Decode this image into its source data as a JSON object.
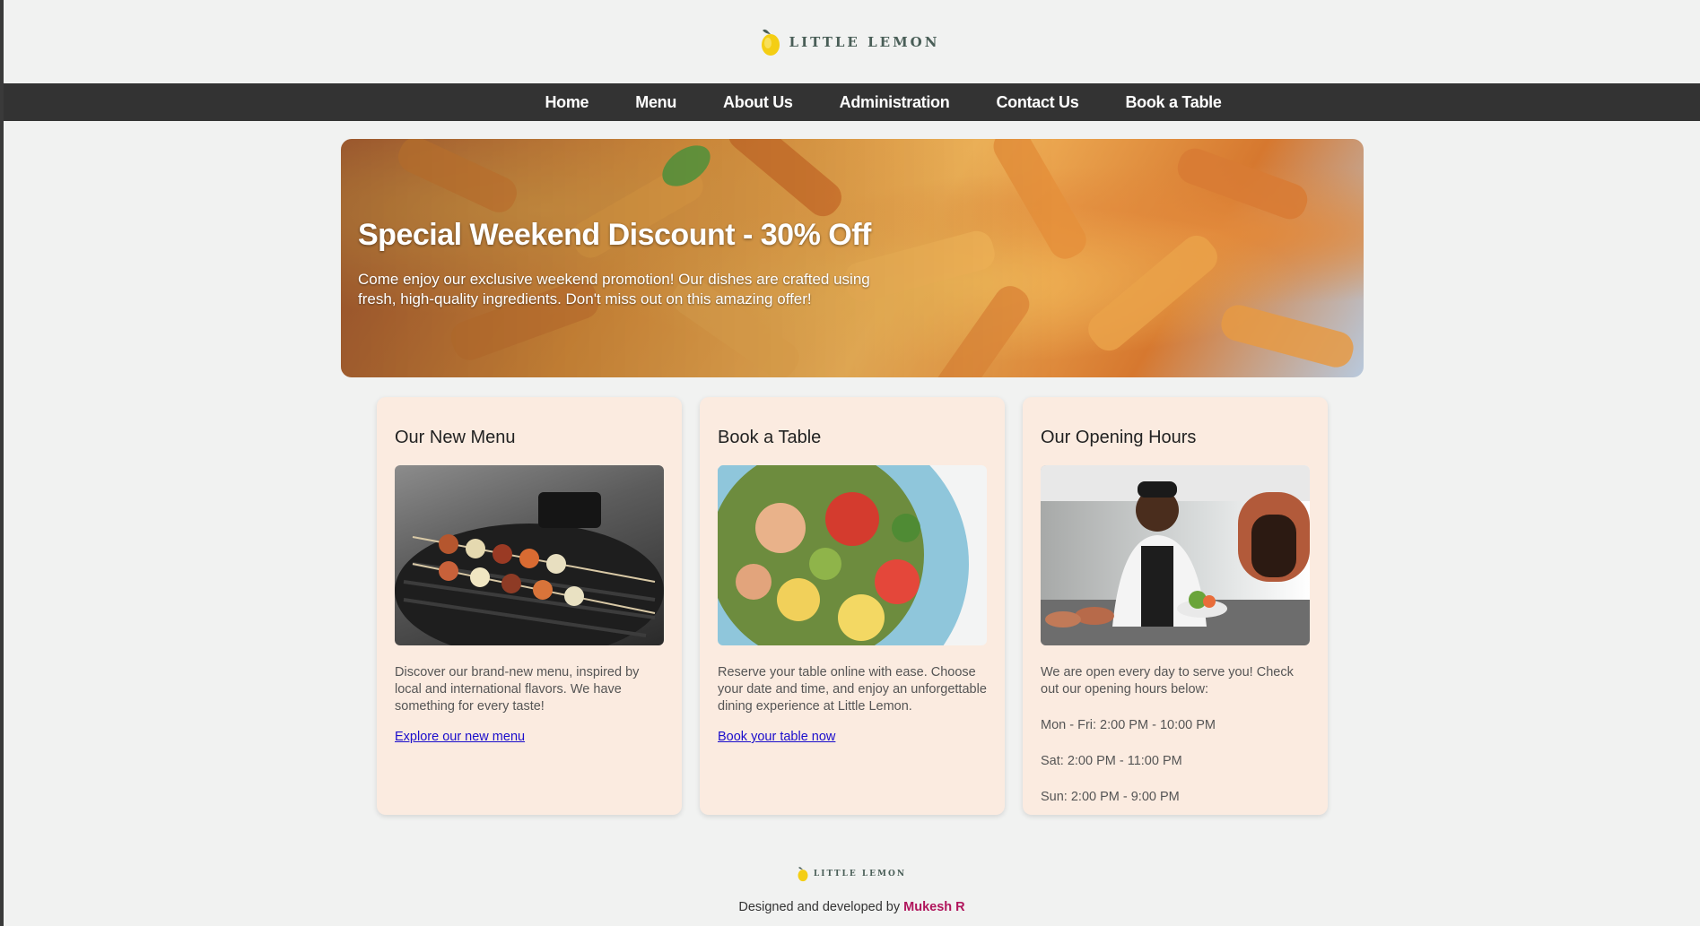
{
  "brand": {
    "name": "LITTLE LEMON"
  },
  "nav": {
    "items": [
      {
        "label": "Home"
      },
      {
        "label": "Menu"
      },
      {
        "label": "About Us"
      },
      {
        "label": "Administration"
      },
      {
        "label": "Contact Us"
      },
      {
        "label": "Book a Table"
      }
    ]
  },
  "hero": {
    "title": "Special Weekend Discount - 30% Off",
    "text": "Come enjoy our exclusive weekend promotion! Our dishes are crafted using fresh, high-quality ingredients. Don't miss out on this amazing offer!"
  },
  "cards": [
    {
      "title": "Our New Menu",
      "text": "Discover our brand-new menu, inspired by local and international flavors. We have something for every taste!",
      "link": "Explore our new menu"
    },
    {
      "title": "Book a Table",
      "text": "Reserve your table online with ease. Choose your date and time, and enjoy an unforgettable dining experience at Little Lemon.",
      "link": "Book your table now"
    },
    {
      "title": "Our Opening Hours",
      "text": "We are open every day to serve you! Check out our opening hours below:",
      "hours": [
        "Mon - Fri: 2:00 PM - 10:00 PM",
        "Sat: 2:00 PM - 11:00 PM",
        "Sun: 2:00 PM - 9:00 PM"
      ]
    }
  ],
  "footer": {
    "brand": "LITTLE LEMON",
    "credit_prefix": "Designed and developed by",
    "author": "Mukesh R"
  },
  "colors": {
    "nav_bg": "#333333",
    "card_bg": "#fbebe0",
    "link": "#1a0dcc",
    "author": "#b0155c",
    "lemon": "#f4ce14"
  }
}
